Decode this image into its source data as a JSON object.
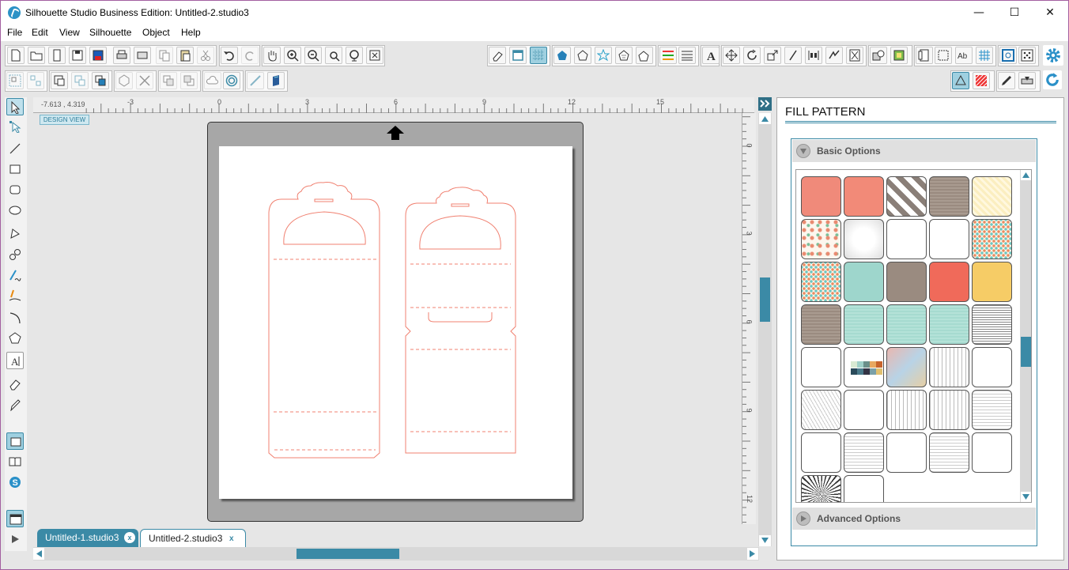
{
  "app": {
    "title": "Silhouette Studio Business Edition: Untitled-2.studio3",
    "window_controls": {
      "minimize": "—",
      "maximize": "☐",
      "close": "✕"
    }
  },
  "menu": [
    "File",
    "Edit",
    "View",
    "Silhouette",
    "Object",
    "Help"
  ],
  "ruler": {
    "coords": "-7.613 , 4.319",
    "h_labels": [
      "-3",
      "0",
      "3",
      "6",
      "9",
      "12",
      "15"
    ],
    "v_labels": [
      "0",
      "3",
      "6",
      "9",
      "12"
    ]
  },
  "design_view": "DESIGN VIEW",
  "tabs": [
    {
      "label": "Untitled-1.studio3",
      "active": false
    },
    {
      "label": "Untitled-2.studio3",
      "active": true
    }
  ],
  "panel": {
    "title": "FILL PATTERN",
    "basic_options": "Basic Options",
    "advanced_options": "Advanced Options"
  },
  "colors": {
    "accent": "#3b8aa6",
    "cut_line": "#f08070",
    "swatch_salmon": "#f08a7a",
    "swatch_teal": "#9ed6cc",
    "swatch_taupe": "#9a8b80",
    "swatch_yellow": "#f6cc66"
  },
  "swatches": [
    [
      "salmon",
      "salmon-2",
      "chevron-gray",
      "taupe-stripe",
      "cream-stripe"
    ],
    [
      "floral",
      "paper-white",
      "blank",
      "blank",
      "polka-dots"
    ],
    [
      "polka-dots",
      "teal",
      "taupe",
      "coral",
      "yellow"
    ],
    [
      "taupe-stripe",
      "teal-light",
      "teal-light",
      "teal-light",
      "newsprint"
    ],
    [
      "blank",
      "color-chips",
      "map",
      "blueprint",
      "blank"
    ],
    [
      "sketch",
      "blank",
      "blueprint",
      "blueprint",
      "document"
    ],
    [
      "blank",
      "document",
      "blank",
      "document",
      "blank"
    ],
    [
      "radial",
      "blank"
    ]
  ]
}
